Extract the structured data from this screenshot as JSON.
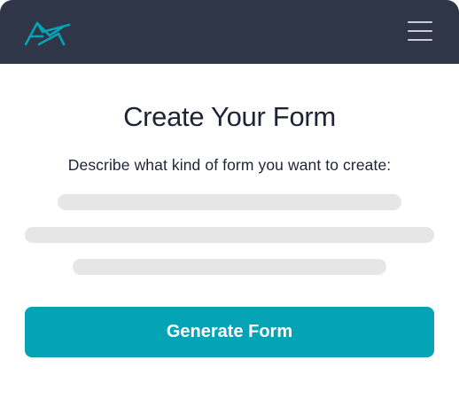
{
  "header": {
    "logo_icon": "grasshopper-logo-icon",
    "menu_icon": "hamburger-menu-icon",
    "accent_color": "#05a3b6",
    "background_color": "#2e3647"
  },
  "main": {
    "title": "Create Your Form",
    "prompt_label": "Describe what kind of form you want to create:",
    "placeholder_lines": 3,
    "generate_button_label": "Generate Form",
    "button_color": "#05a3b6"
  }
}
